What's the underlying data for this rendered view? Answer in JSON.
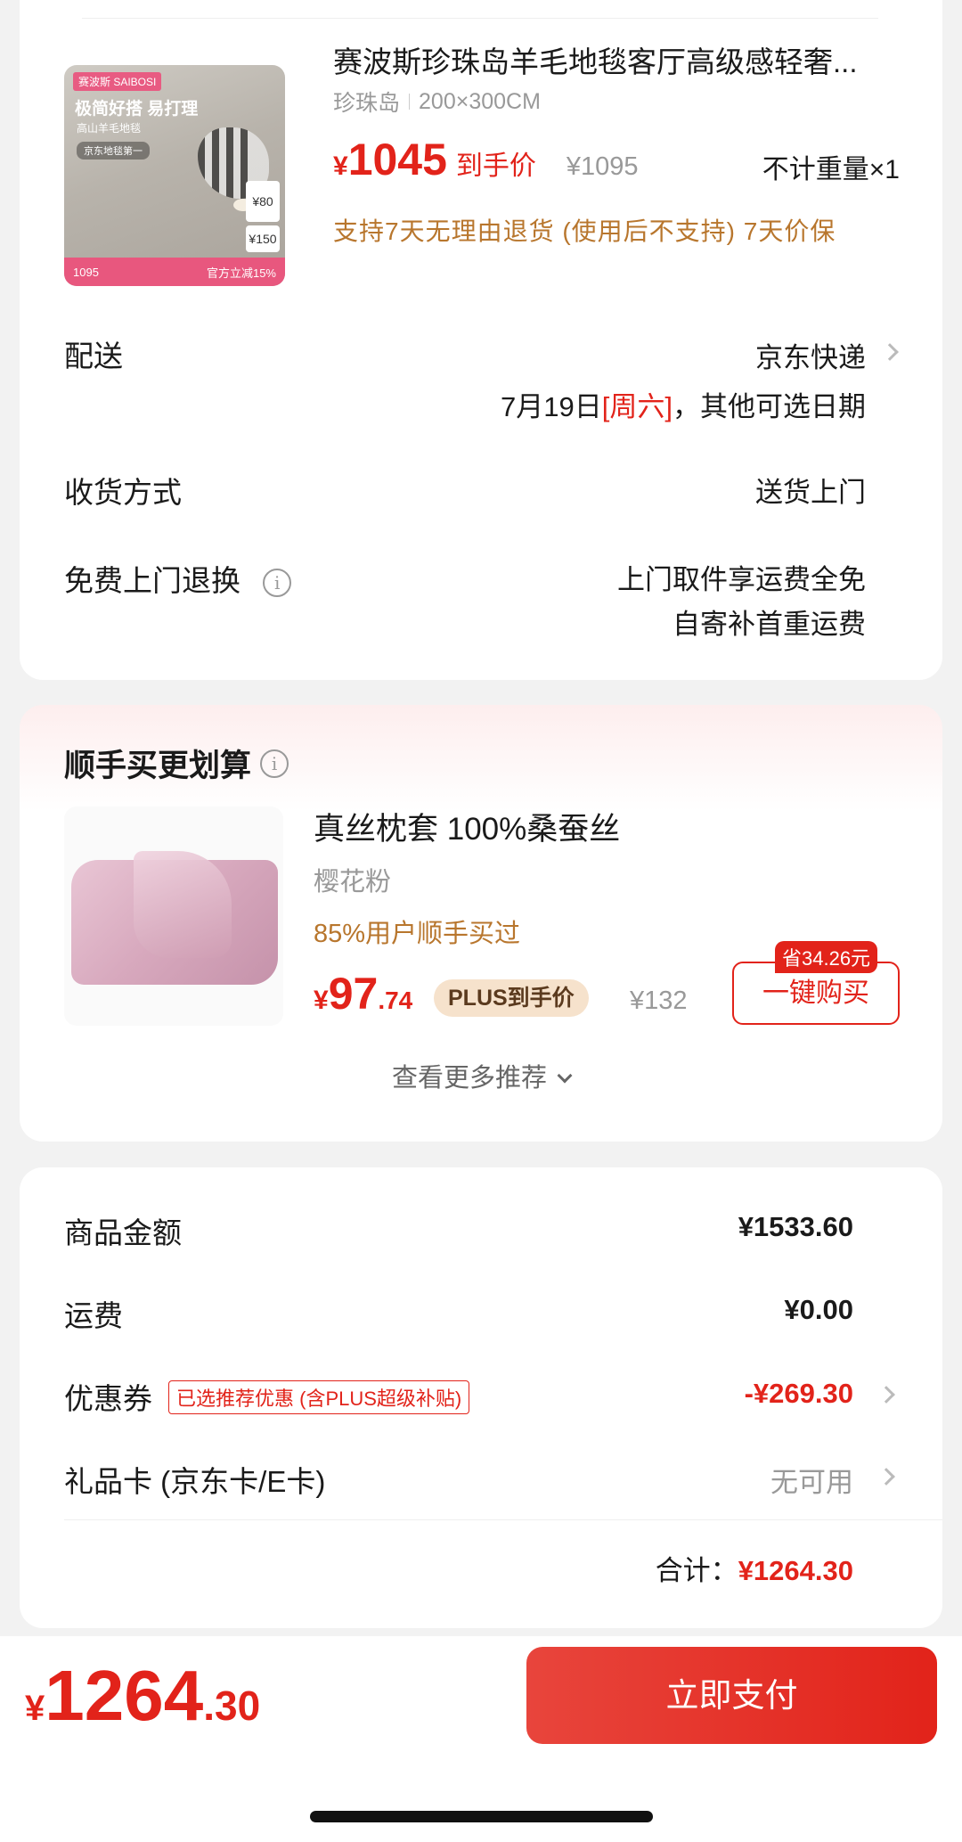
{
  "product": {
    "title": "赛波斯珍珠岛羊毛地毯客厅高级感轻奢...",
    "spec_name": "珍珠岛",
    "spec_size": "200×300CM",
    "currency": "¥",
    "price": "1045",
    "price_label": "到手价",
    "original_price": "¥1095",
    "quantity": "不计重量×1",
    "support": "支持7天无理由退货 (使用后不支持)  7天价保",
    "thumb": {
      "brand": "赛波斯 SAIBOSI",
      "slogan": "极简好搭 易打理",
      "sub": "高山羊毛地毯",
      "rank": "京东地毯第一",
      "tag1": "¥80",
      "tag2": "¥150",
      "band_left": "1095",
      "band_right": "官方立减15%"
    }
  },
  "delivery": {
    "label": "配送",
    "method": "京东快递",
    "date": "7月19日",
    "weekday": "[周六]",
    "other": "，其他可选日期"
  },
  "receive": {
    "label": "收货方式",
    "value": "送货上门"
  },
  "returns": {
    "label": "免费上门退换",
    "line1": "上门取件享运费全免",
    "line2": "自寄补首重运费"
  },
  "suggest": {
    "title": "顺手买更划算",
    "item_title": "真丝枕套 100%桑蚕丝",
    "color": "樱花粉",
    "bought": "85%用户顺手买过",
    "currency": "¥",
    "price_int": "97",
    "price_dec": ".74",
    "plus_label": "PLUS到手价",
    "orig": "¥132",
    "save": "省34.26元",
    "buy": "一键购买",
    "see_more": "查看更多推荐"
  },
  "summary": {
    "goods_label": "商品金额",
    "goods_value": "¥1533.60",
    "shipping_label": "运费",
    "shipping_value": "¥0.00",
    "coupon_label": "优惠券",
    "coupon_tag": "已选推荐优惠 (含PLUS超级补贴)",
    "coupon_value": "-¥269.30",
    "gift_label": "礼品卡 (京东卡/E卡)",
    "gift_value": "无可用",
    "total_label": "合计：",
    "total_value": "¥1264.30"
  },
  "footer": {
    "currency": "¥",
    "price_int": "1264",
    "price_dec": ".30",
    "pay_label": "立即支付"
  },
  "colors": {
    "accent": "#e2231a",
    "gold": "#b8762d",
    "background": "#f2f2f2"
  }
}
